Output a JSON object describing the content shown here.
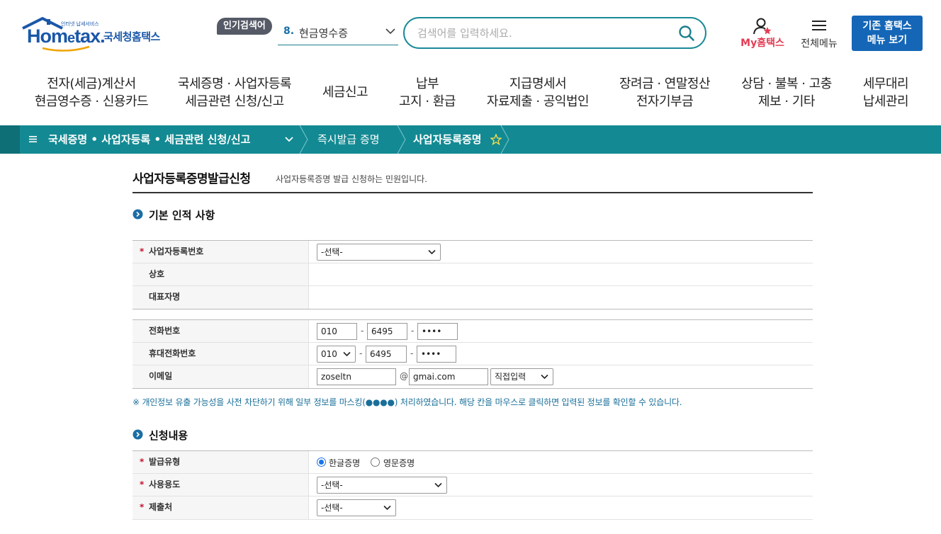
{
  "header": {
    "logo_sub": "인터넷 납세서비스",
    "logo_brand_pre": "Hom",
    "logo_brand_e": "e",
    "logo_brand_post": "tax.",
    "logo_kname": "국세청홈택스",
    "popular_badge": "인기검색어",
    "popular_num": "8.",
    "popular_text": "현금영수증",
    "search_placeholder": "검색어를 입력하세요.",
    "my_hometax": "My홈택스",
    "all_menu": "전체메뉴",
    "legacy_line1": "기존 홈택스",
    "legacy_line2": "메뉴 보기"
  },
  "gnb": [
    {
      "line1": "전자(세금)계산서",
      "line2": "현금영수증 · 신용카드"
    },
    {
      "line1": "국세증명 · 사업자등록",
      "line2": "세금관련 신청/신고"
    },
    {
      "line1": "세금신고",
      "line2": ""
    },
    {
      "line1": "납부",
      "line2": "고지 · 환급"
    },
    {
      "line1": "지급명세서",
      "line2": "자료제출 · 공익법인"
    },
    {
      "line1": "장려금 · 연말정산",
      "line2": "전자기부금"
    },
    {
      "line1": "상담 · 불복 · 고충",
      "line2": "제보 · 기타"
    },
    {
      "line1": "세무대리",
      "line2": "납세관리"
    }
  ],
  "breadcrumb": {
    "level1": "국세증명 • 사업자등록 • 세금관련 신청/신고",
    "level2": "즉시발급 증명",
    "level3": "사업자등록증명"
  },
  "page": {
    "title": "사업자등록증명발급신청",
    "desc": "사업자등록증명 발급 신청하는 민원입니다."
  },
  "section1": {
    "title": "기본 인적 사항",
    "biz_no_label": "사업자등록번호",
    "biz_no_value": "-선택-",
    "company_label": "상호",
    "rep_label": "대표자명",
    "phone_label": "전화번호",
    "phone_1": "010",
    "phone_2": "6495",
    "phone_3": "••••",
    "mobile_label": "휴대전화번호",
    "mobile_1": "010",
    "mobile_2": "6495",
    "mobile_3": "••••",
    "email_label": "이메일",
    "email_id": "zoseltn",
    "email_at": "@",
    "email_domain": "gmai.com",
    "email_select": "직접입력",
    "dash": "-"
  },
  "notice": "※ 개인정보 유출 가능성을 사전 차단하기 위해 일부 정보를 마스킹(●●●●) 처리하였습니다. 해당 칸을 마우스로 클릭하면 입력된 정보를 확인할 수 있습니다.",
  "section2": {
    "title": "신청내용",
    "type_label": "발급유형",
    "type_korean": "한글증명",
    "type_english": "영문증명",
    "usage_label": "사용용도",
    "usage_value": "-선택-",
    "submit_label": "제출처",
    "submit_value": "-선택-"
  },
  "required_mark": "*",
  "colors": {
    "teal": "#138a93",
    "brand_blue": "#1a57a8",
    "button_blue": "#1566b7",
    "accent_red": "#e33d55"
  }
}
